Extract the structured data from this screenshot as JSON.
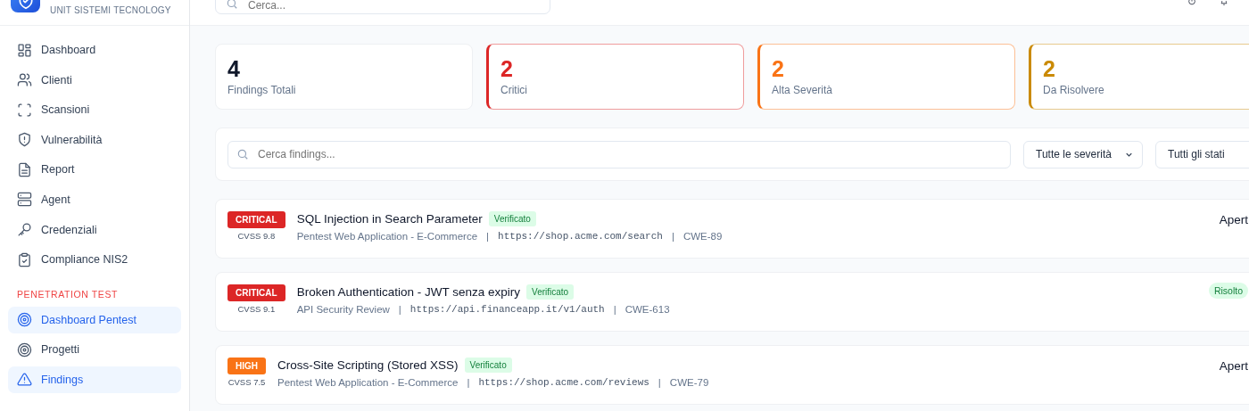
{
  "brand": {
    "subtitle": "UNIT SISTEMI TECNOLOGY"
  },
  "header": {
    "search_placeholder": "Cerca..."
  },
  "sidebar": {
    "items": [
      {
        "label": "Dashboard",
        "selected": false
      },
      {
        "label": "Clienti",
        "selected": false
      },
      {
        "label": "Scansioni",
        "selected": false
      },
      {
        "label": "Vulnerabilità",
        "selected": false
      },
      {
        "label": "Report",
        "selected": false
      },
      {
        "label": "Agent",
        "selected": false
      },
      {
        "label": "Credenziali",
        "selected": false
      },
      {
        "label": "Compliance NIS2",
        "selected": false
      }
    ],
    "section": {
      "title": "PENETRATION TEST",
      "items": [
        {
          "label": "Dashboard Pentest",
          "selected": true
        },
        {
          "label": "Progetti",
          "selected": false
        },
        {
          "label": "Findings",
          "selected": true
        }
      ]
    }
  },
  "stats": [
    {
      "value": "4",
      "label": "Findings Totali",
      "color": "#0f172a"
    },
    {
      "value": "2",
      "label": "Critici",
      "color": "#dc2626"
    },
    {
      "value": "2",
      "label": "Alta Severità",
      "color": "#f97316"
    },
    {
      "value": "2",
      "label": "Da Risolvere",
      "color": "#ca8a04"
    }
  ],
  "filters": {
    "search_placeholder": "Cerca findings...",
    "selects": [
      {
        "value": "Tutte le severità"
      },
      {
        "value": "Tutti gli stati"
      }
    ]
  },
  "findings": [
    {
      "severity": "CRITICAL",
      "kind": "critical",
      "cvss": "CVSS 9.8",
      "title": "SQL Injection in Search Parameter",
      "badge": "Verificato",
      "meta": [
        {
          "kind": "project",
          "text": "Pentest Web Application - E-Commerce"
        },
        {
          "kind": "separator",
          "text": "|"
        },
        {
          "kind": "url",
          "text": "https://shop.acme.com/search"
        },
        {
          "kind": "separator",
          "text": "|"
        },
        {
          "kind": "cwe",
          "text": "CWE-89"
        }
      ],
      "status": "Apert",
      "status_badge": false
    },
    {
      "severity": "CRITICAL",
      "kind": "critical",
      "cvss": "CVSS 9.1",
      "title": "Broken Authentication - JWT senza expiry",
      "badge": "Verificato",
      "meta": [
        {
          "kind": "project",
          "text": "API Security Review"
        },
        {
          "kind": "separator",
          "text": "|"
        },
        {
          "kind": "url",
          "text": "https://api.financeapp.it/v1/auth"
        },
        {
          "kind": "separator",
          "text": "|"
        },
        {
          "kind": "cwe",
          "text": "CWE-613"
        }
      ],
      "status": "Risolto",
      "status_badge": true
    },
    {
      "severity": "HIGH",
      "kind": "high",
      "cvss": "CVSS 7.5",
      "title": "Cross-Site Scripting (Stored XSS)",
      "badge": "Verificato",
      "meta": [
        {
          "kind": "project",
          "text": "Pentest Web Application - E-Commerce"
        },
        {
          "kind": "separator",
          "text": "|"
        },
        {
          "kind": "url",
          "text": "https://shop.acme.com/reviews"
        },
        {
          "kind": "separator",
          "text": "|"
        },
        {
          "kind": "cwe",
          "text": "CWE-79"
        }
      ],
      "status": "Apert",
      "status_badge": false
    }
  ]
}
